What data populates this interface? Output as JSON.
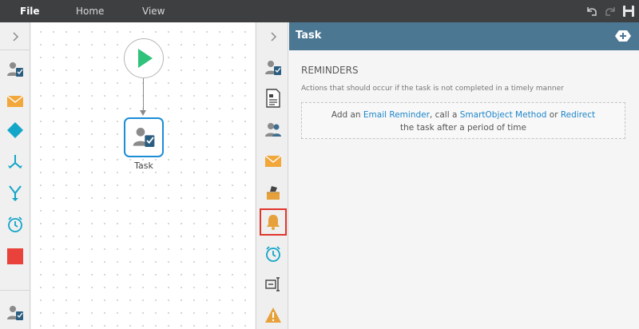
{
  "menu": {
    "file": "File",
    "home": "Home",
    "view": "View"
  },
  "canvas": {
    "task_label": "Task"
  },
  "panel": {
    "title": "Task",
    "section_title": "REMINDERS",
    "description": "Actions that should occur if the task is not completed in a timely manner",
    "reminder": {
      "prefix": "Add an ",
      "email_link": "Email Reminder",
      "mid1": ", call a ",
      "smartobject_link": "SmartObject Method",
      "mid2": " or ",
      "redirect_link": "Redirect",
      "line2": "the task after a period of time"
    }
  },
  "colors": {
    "menubar": "#3d3f41",
    "header": "#4c7793",
    "link": "#1d85c9",
    "task_border": "#1b8ed6",
    "active_outline": "#e0352b"
  },
  "icons": {
    "toolbox": [
      "expand-chevron-icon",
      "user-task-icon",
      "email-icon",
      "decision-diamond-icon",
      "split-arrows-icon",
      "merge-arrows-icon",
      "timer-icon",
      "end-stop-icon",
      "user-task-icon"
    ],
    "property_strip": [
      "expand-chevron-icon",
      "task-user-icon",
      "form-document-icon",
      "participants-icon",
      "email-icon",
      "outcomes-icon",
      "reminder-bell-icon",
      "escalation-timer-icon",
      "rename-field-icon",
      "warning-icon"
    ]
  }
}
